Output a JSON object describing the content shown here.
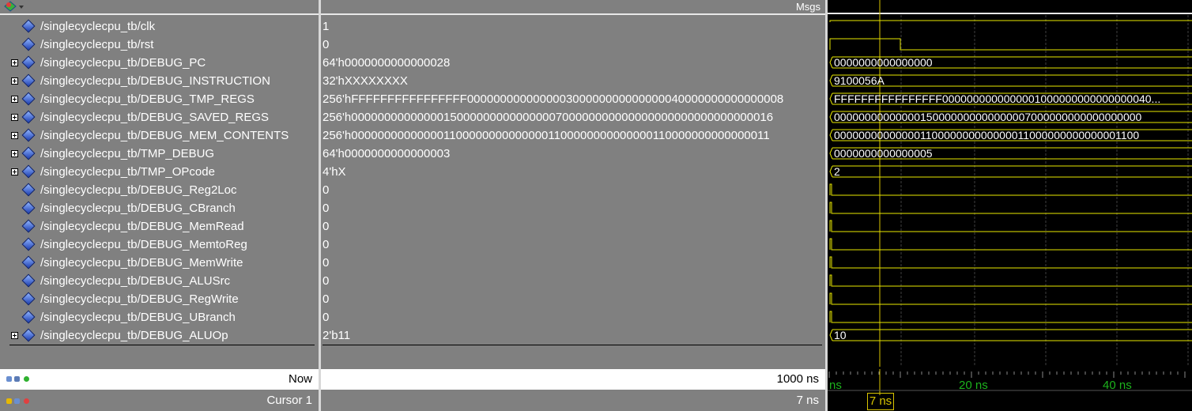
{
  "header": {
    "msgs_label": "Msgs"
  },
  "signals": [
    {
      "name": "/singlecyclecpu_tb/clk",
      "value": "1",
      "expandable": false,
      "wave": ""
    },
    {
      "name": "/singlecyclecpu_tb/rst",
      "value": "0",
      "expandable": false,
      "wave": ""
    },
    {
      "name": "/singlecyclecpu_tb/DEBUG_PC",
      "value": "64'h0000000000000028",
      "expandable": true,
      "wave": "0000000000000000"
    },
    {
      "name": "/singlecyclecpu_tb/DEBUG_INSTRUCTION",
      "value": "32'hXXXXXXXX",
      "expandable": true,
      "wave": "9100056A"
    },
    {
      "name": "/singlecyclecpu_tb/DEBUG_TMP_REGS",
      "value": "256'hFFFFFFFFFFFFFFFF000000000000000300000000000000040000000000000008",
      "expandable": true,
      "wave": "FFFFFFFFFFFFFFFF0000000000000001000000000000000040..."
    },
    {
      "name": "/singlecyclecpu_tb/DEBUG_SAVED_REGS",
      "value": "256'h0000000000000015000000000000000700000000000000000000000000000016",
      "expandable": true,
      "wave": "00000000000000150000000000000007000000000000000000"
    },
    {
      "name": "/singlecyclecpu_tb/DEBUG_MEM_CONTENTS",
      "value": "256'h0000000000000011000000000000001100000000000000110000000000000011",
      "expandable": true,
      "wave": "00000000000000110000000000000011000000000000001100"
    },
    {
      "name": "/singlecyclecpu_tb/TMP_DEBUG",
      "value": "64'h0000000000000003",
      "expandable": true,
      "wave": "0000000000000005"
    },
    {
      "name": "/singlecyclecpu_tb/TMP_OPcode",
      "value": "4'hX",
      "expandable": true,
      "wave": "2"
    },
    {
      "name": "/singlecyclecpu_tb/DEBUG_Reg2Loc",
      "value": "0",
      "expandable": false,
      "wave": ""
    },
    {
      "name": "/singlecyclecpu_tb/DEBUG_CBranch",
      "value": "0",
      "expandable": false,
      "wave": ""
    },
    {
      "name": "/singlecyclecpu_tb/DEBUG_MemRead",
      "value": "0",
      "expandable": false,
      "wave": ""
    },
    {
      "name": "/singlecyclecpu_tb/DEBUG_MemtoReg",
      "value": "0",
      "expandable": false,
      "wave": ""
    },
    {
      "name": "/singlecyclecpu_tb/DEBUG_MemWrite",
      "value": "0",
      "expandable": false,
      "wave": ""
    },
    {
      "name": "/singlecyclecpu_tb/DEBUG_ALUSrc",
      "value": "0",
      "expandable": false,
      "wave": ""
    },
    {
      "name": "/singlecyclecpu_tb/DEBUG_RegWrite",
      "value": "0",
      "expandable": false,
      "wave": ""
    },
    {
      "name": "/singlecyclecpu_tb/DEBUG_UBranch",
      "value": "0",
      "expandable": false,
      "wave": ""
    },
    {
      "name": "/singlecyclecpu_tb/DEBUG_ALUOp",
      "value": "2'b11",
      "expandable": true,
      "wave": "10"
    }
  ],
  "footer": {
    "now_label": "Now",
    "now_value": "1000 ns",
    "cursor_label": "Cursor 1",
    "cursor_value": "7 ns",
    "cursor_marker": "7 ns"
  },
  "timeline": {
    "labels": [
      "ns",
      "20 ns",
      "40 ns"
    ]
  },
  "colors": {
    "wave": "#e8e800",
    "cursor": "#d8c400",
    "grid": "#404040",
    "time_text": "#1db31d",
    "pane_bg": "#808080"
  }
}
